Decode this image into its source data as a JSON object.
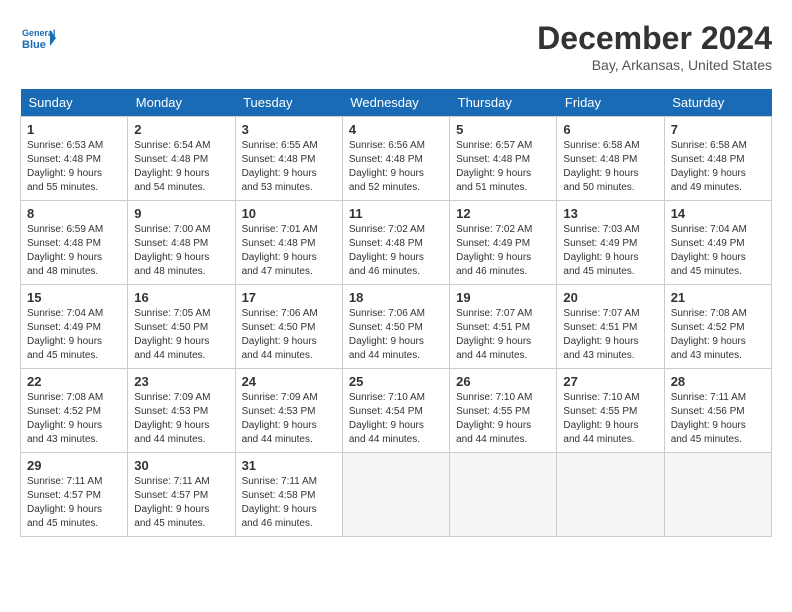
{
  "header": {
    "logo_line1": "General",
    "logo_line2": "Blue",
    "month": "December 2024",
    "location": "Bay, Arkansas, United States"
  },
  "weekdays": [
    "Sunday",
    "Monday",
    "Tuesday",
    "Wednesday",
    "Thursday",
    "Friday",
    "Saturday"
  ],
  "weeks": [
    [
      {
        "day": "1",
        "sunrise": "6:53 AM",
        "sunset": "4:48 PM",
        "daylight": "9 hours and 55 minutes."
      },
      {
        "day": "2",
        "sunrise": "6:54 AM",
        "sunset": "4:48 PM",
        "daylight": "9 hours and 54 minutes."
      },
      {
        "day": "3",
        "sunrise": "6:55 AM",
        "sunset": "4:48 PM",
        "daylight": "9 hours and 53 minutes."
      },
      {
        "day": "4",
        "sunrise": "6:56 AM",
        "sunset": "4:48 PM",
        "daylight": "9 hours and 52 minutes."
      },
      {
        "day": "5",
        "sunrise": "6:57 AM",
        "sunset": "4:48 PM",
        "daylight": "9 hours and 51 minutes."
      },
      {
        "day": "6",
        "sunrise": "6:58 AM",
        "sunset": "4:48 PM",
        "daylight": "9 hours and 50 minutes."
      },
      {
        "day": "7",
        "sunrise": "6:58 AM",
        "sunset": "4:48 PM",
        "daylight": "9 hours and 49 minutes."
      }
    ],
    [
      {
        "day": "8",
        "sunrise": "6:59 AM",
        "sunset": "4:48 PM",
        "daylight": "9 hours and 48 minutes."
      },
      {
        "day": "9",
        "sunrise": "7:00 AM",
        "sunset": "4:48 PM",
        "daylight": "9 hours and 48 minutes."
      },
      {
        "day": "10",
        "sunrise": "7:01 AM",
        "sunset": "4:48 PM",
        "daylight": "9 hours and 47 minutes."
      },
      {
        "day": "11",
        "sunrise": "7:02 AM",
        "sunset": "4:48 PM",
        "daylight": "9 hours and 46 minutes."
      },
      {
        "day": "12",
        "sunrise": "7:02 AM",
        "sunset": "4:49 PM",
        "daylight": "9 hours and 46 minutes."
      },
      {
        "day": "13",
        "sunrise": "7:03 AM",
        "sunset": "4:49 PM",
        "daylight": "9 hours and 45 minutes."
      },
      {
        "day": "14",
        "sunrise": "7:04 AM",
        "sunset": "4:49 PM",
        "daylight": "9 hours and 45 minutes."
      }
    ],
    [
      {
        "day": "15",
        "sunrise": "7:04 AM",
        "sunset": "4:49 PM",
        "daylight": "9 hours and 45 minutes."
      },
      {
        "day": "16",
        "sunrise": "7:05 AM",
        "sunset": "4:50 PM",
        "daylight": "9 hours and 44 minutes."
      },
      {
        "day": "17",
        "sunrise": "7:06 AM",
        "sunset": "4:50 PM",
        "daylight": "9 hours and 44 minutes."
      },
      {
        "day": "18",
        "sunrise": "7:06 AM",
        "sunset": "4:50 PM",
        "daylight": "9 hours and 44 minutes."
      },
      {
        "day": "19",
        "sunrise": "7:07 AM",
        "sunset": "4:51 PM",
        "daylight": "9 hours and 44 minutes."
      },
      {
        "day": "20",
        "sunrise": "7:07 AM",
        "sunset": "4:51 PM",
        "daylight": "9 hours and 43 minutes."
      },
      {
        "day": "21",
        "sunrise": "7:08 AM",
        "sunset": "4:52 PM",
        "daylight": "9 hours and 43 minutes."
      }
    ],
    [
      {
        "day": "22",
        "sunrise": "7:08 AM",
        "sunset": "4:52 PM",
        "daylight": "9 hours and 43 minutes."
      },
      {
        "day": "23",
        "sunrise": "7:09 AM",
        "sunset": "4:53 PM",
        "daylight": "9 hours and 44 minutes."
      },
      {
        "day": "24",
        "sunrise": "7:09 AM",
        "sunset": "4:53 PM",
        "daylight": "9 hours and 44 minutes."
      },
      {
        "day": "25",
        "sunrise": "7:10 AM",
        "sunset": "4:54 PM",
        "daylight": "9 hours and 44 minutes."
      },
      {
        "day": "26",
        "sunrise": "7:10 AM",
        "sunset": "4:55 PM",
        "daylight": "9 hours and 44 minutes."
      },
      {
        "day": "27",
        "sunrise": "7:10 AM",
        "sunset": "4:55 PM",
        "daylight": "9 hours and 44 minutes."
      },
      {
        "day": "28",
        "sunrise": "7:11 AM",
        "sunset": "4:56 PM",
        "daylight": "9 hours and 45 minutes."
      }
    ],
    [
      {
        "day": "29",
        "sunrise": "7:11 AM",
        "sunset": "4:57 PM",
        "daylight": "9 hours and 45 minutes."
      },
      {
        "day": "30",
        "sunrise": "7:11 AM",
        "sunset": "4:57 PM",
        "daylight": "9 hours and 45 minutes."
      },
      {
        "day": "31",
        "sunrise": "7:11 AM",
        "sunset": "4:58 PM",
        "daylight": "9 hours and 46 minutes."
      },
      null,
      null,
      null,
      null
    ]
  ]
}
